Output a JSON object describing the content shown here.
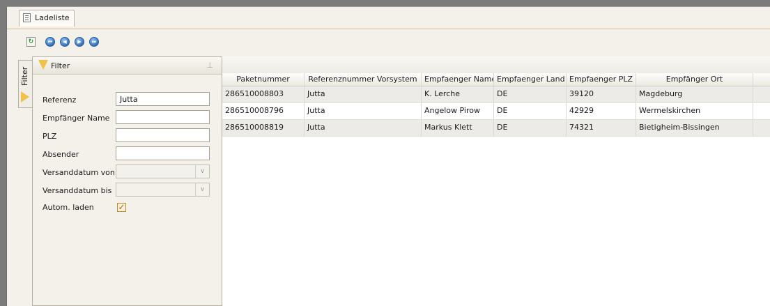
{
  "tab": {
    "title": "Ladeliste"
  },
  "toolbar": {
    "refresh_icon": "refresh-icon",
    "nav_icons": [
      "first-icon",
      "previous-icon",
      "next-icon",
      "last-icon"
    ]
  },
  "side_tab": {
    "label": "Filter"
  },
  "filter": {
    "title": "Filter",
    "fields": [
      {
        "label": "Referenz",
        "value": "Jutta"
      },
      {
        "label": "Empfänger Name",
        "value": ""
      },
      {
        "label": "PLZ",
        "value": ""
      },
      {
        "label": "Absender",
        "value": ""
      },
      {
        "label": "Versanddatum von",
        "value": ""
      },
      {
        "label": "Versanddatum bis",
        "value": ""
      },
      {
        "label": "Autom. laden",
        "checked": true
      }
    ]
  },
  "grid": {
    "columns": [
      "Paketnummer",
      "Referenznummer Vorsystem",
      "Empfaenger Name",
      "Empfaenger Land",
      "Empfaenger PLZ",
      "Empfänger Ort"
    ],
    "rows": [
      [
        "286510008803",
        "Jutta",
        "K. Lerche",
        "DE",
        "39120",
        "Magdeburg"
      ],
      [
        "286510008796",
        "Jutta",
        "Angelow Pirow",
        "DE",
        "42929",
        "Wermelskirchen"
      ],
      [
        "286510008819",
        "Jutta",
        "Markus Klett",
        "DE",
        "74321",
        "Bietigheim-Bissingen"
      ]
    ]
  },
  "colors": {
    "accent": "#f1c24a",
    "nav_blue": "#2f6fb8"
  }
}
